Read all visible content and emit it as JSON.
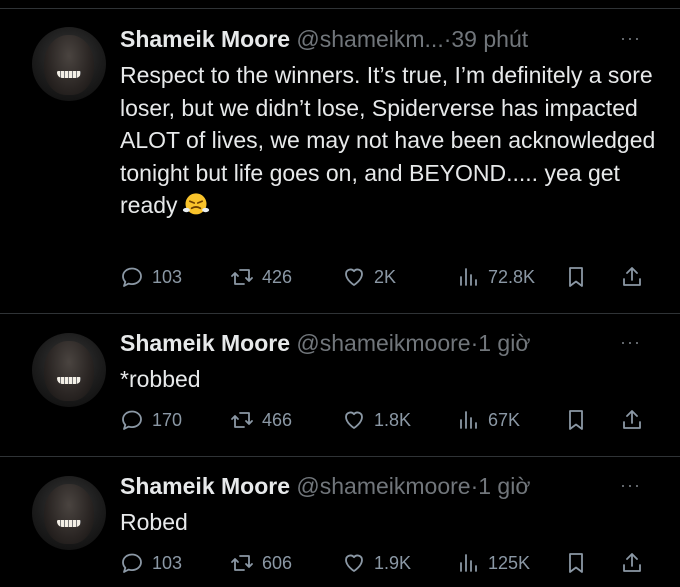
{
  "tweets": [
    {
      "name": "Shameik Moore",
      "handle": "@shameikm...",
      "dot": "·",
      "time": "39 phút",
      "more": "···",
      "text": "Respect to the winners. It’s true, I’m definitely a sore loser, but we didn’t lose, Spiderverse has impacted ALOT of lives, we may not have been acknowledged tonight but life goes on, and BEYOND..... yea get ready",
      "emoji": "face-with-steam-from-nose-emoji",
      "replies": "103",
      "retweets": "426",
      "likes": "2K",
      "views": "72.8K"
    },
    {
      "name": "Shameik Moore",
      "handle": "@shameikmoore",
      "dot": "·",
      "time": "1 giờ",
      "more": "···",
      "text": "*robbed",
      "replies": "170",
      "retweets": "466",
      "likes": "1.8K",
      "views": "67K"
    },
    {
      "name": "Shameik Moore",
      "handle": "@shameikmoore",
      "dot": "·",
      "time": "1 giờ",
      "more": "···",
      "text": "Robed",
      "replies": "103",
      "retweets": "606",
      "likes": "1.9K",
      "views": "125K"
    }
  ],
  "icons": {
    "reply": "reply-icon",
    "retweet": "retweet-icon",
    "like": "heart-icon",
    "views": "views-chart-icon",
    "bookmark": "bookmark-icon",
    "share": "share-icon"
  },
  "colors": {
    "background": "#000000",
    "text": "#e7e9ea",
    "secondary": "#71767b",
    "divider": "#2f3336"
  }
}
